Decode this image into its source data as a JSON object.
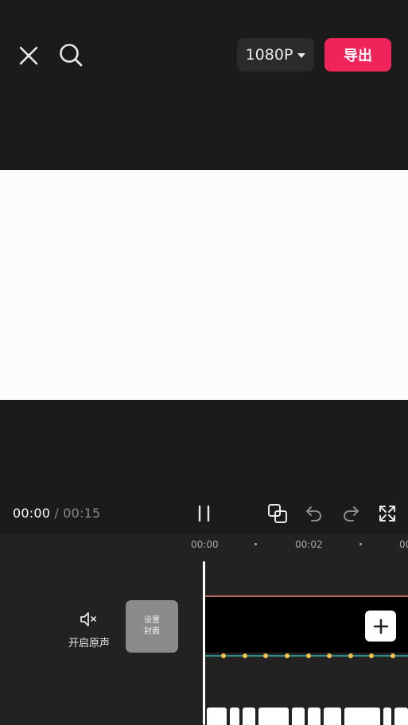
{
  "header": {
    "resolution_label": "1080P",
    "export_label": "导出"
  },
  "playback": {
    "current_time": "00:00",
    "separator": "/",
    "total_time": "00:15"
  },
  "timeline": {
    "ticks": [
      "00:00",
      "00:02",
      "00"
    ],
    "mute_label": "开启原声",
    "cover_line1": "设置",
    "cover_line2": "封面"
  },
  "colors": {
    "accent": "#f0245a",
    "background": "#1b1b1b",
    "timeline_bg": "#222222",
    "beat_marker": "#f6c24a",
    "beat_line": "#2f8a88"
  },
  "icons": [
    "close-icon",
    "search-icon",
    "pause-icon",
    "overlay-icon",
    "undo-icon",
    "redo-icon",
    "fullscreen-icon",
    "mute-icon",
    "plus-icon"
  ]
}
